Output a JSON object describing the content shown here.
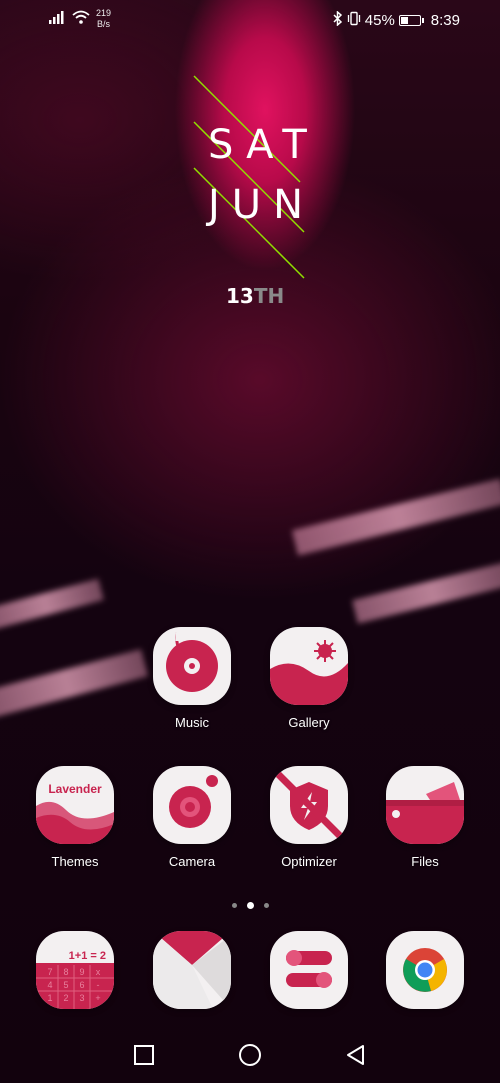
{
  "status_bar": {
    "net_speed_value": "219",
    "net_speed_unit": "B/s",
    "battery_percent": "45%",
    "battery_level": 0.45,
    "time": "8:39"
  },
  "clock_widget": {
    "day": "SAT",
    "month": "JUN",
    "date_number": "13",
    "date_suffix": "TH"
  },
  "apps": [
    {
      "label": "Music"
    },
    {
      "label": "Gallery"
    },
    {
      "label": "Themes",
      "icon_text": "Lavender"
    },
    {
      "label": "Camera"
    },
    {
      "label": "Optimizer"
    },
    {
      "label": "Files"
    }
  ],
  "dock": [
    {
      "name": "calculator",
      "icon_text": "1+1 = 2"
    },
    {
      "name": "email"
    },
    {
      "name": "settings"
    },
    {
      "name": "chrome"
    }
  ],
  "page_indicator": {
    "pages": 3,
    "active": 1
  },
  "colors": {
    "accent": "#c8244f",
    "icon_bg": "#f3f0f1",
    "clock_line": "#8fe000"
  }
}
